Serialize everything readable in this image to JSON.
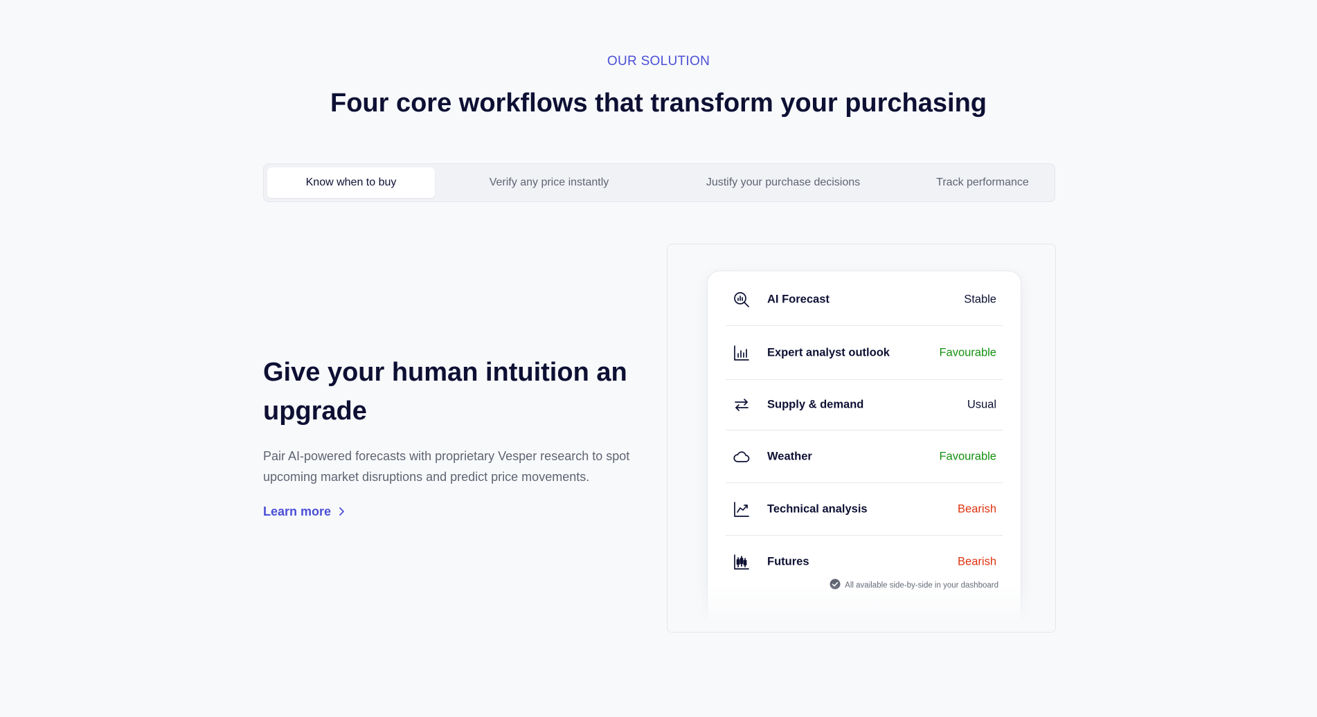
{
  "section": {
    "eyebrow": "OUR SOLUTION",
    "headline": "Four core workflows that transform your purchasing"
  },
  "tabs": [
    {
      "label": "Know when to buy",
      "active": true
    },
    {
      "label": "Verify any price instantly",
      "active": false
    },
    {
      "label": "Justify your purchase decisions",
      "active": false
    },
    {
      "label": "Track performance",
      "active": false
    }
  ],
  "feature": {
    "title": "Give your human intuition an upgrade",
    "description": "Pair AI-powered forecasts with proprietary Vesper research to spot upcoming market disruptions and predict price movements.",
    "learn_more": "Learn more"
  },
  "signals": [
    {
      "icon": "magnifier-chart-icon",
      "label": "AI Forecast",
      "value": "Stable",
      "color": "#0d1033"
    },
    {
      "icon": "bar-chart-icon",
      "label": "Expert analyst outlook",
      "value": "Favourable",
      "color": "#13900f"
    },
    {
      "icon": "exchange-arrows-icon",
      "label": "Supply & demand",
      "value": "Usual",
      "color": "#0d1033"
    },
    {
      "icon": "cloud-icon",
      "label": "Weather",
      "value": "Favourable",
      "color": "#13900f"
    },
    {
      "icon": "trend-line-icon",
      "label": "Technical analysis",
      "value": "Bearish",
      "color": "#e0330f"
    },
    {
      "icon": "candlestick-icon",
      "label": "Futures",
      "value": "Bearish",
      "color": "#e0330f"
    }
  ],
  "footnote": "All available side-by-side in your dashboard",
  "colors": {
    "accent": "#4a4fd6",
    "text": "#0d1033",
    "muted": "#5f6472",
    "favourable": "#13900f",
    "bearish": "#e0330f",
    "background": "#f8f9fb"
  }
}
